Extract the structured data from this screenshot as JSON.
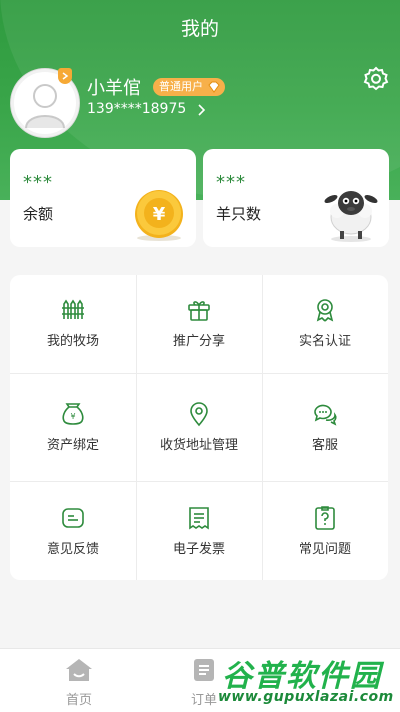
{
  "header": {
    "title": "我的"
  },
  "profile": {
    "username": "小羊倌",
    "user_type": "普通用户",
    "phone": "139****18975"
  },
  "cards": {
    "balance": {
      "value": "***",
      "label": "余额"
    },
    "sheep": {
      "value": "***",
      "label": "羊只数"
    }
  },
  "menu": [
    {
      "label": "我的牧场",
      "icon": "fence-icon"
    },
    {
      "label": "推广分享",
      "icon": "gift-icon"
    },
    {
      "label": "实名认证",
      "icon": "award-icon"
    },
    {
      "label": "资产绑定",
      "icon": "money-bag-icon"
    },
    {
      "label": "收货地址管理",
      "icon": "location-pin-icon"
    },
    {
      "label": "客服",
      "icon": "chat-icon"
    },
    {
      "label": "意见反馈",
      "icon": "feedback-icon"
    },
    {
      "label": "电子发票",
      "icon": "receipt-icon"
    },
    {
      "label": "常见问题",
      "icon": "question-icon"
    }
  ],
  "tabbar": {
    "home": "首页",
    "orders": "订单"
  },
  "watermark": {
    "name": "谷普软件园",
    "url": "www.gupuxlazai.com"
  },
  "colors": {
    "brand_green": "#3aa64a",
    "accent_green": "#2e8b3d",
    "badge_orange": "#f7b04a"
  }
}
